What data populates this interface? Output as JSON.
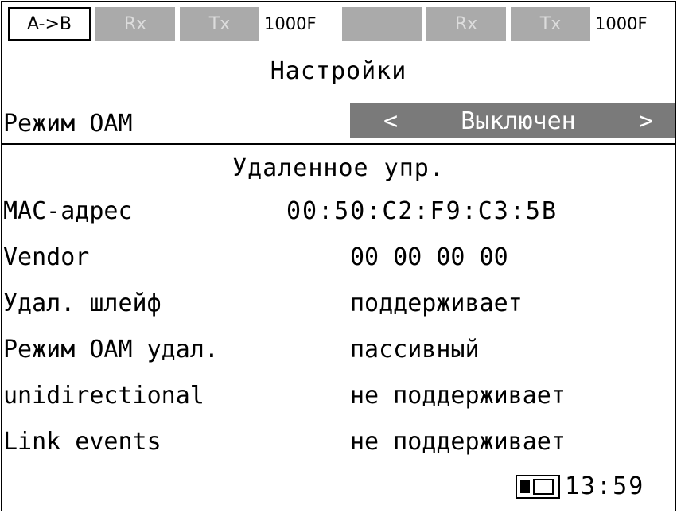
{
  "topbar": {
    "mode": "A->B",
    "port1": {
      "rx": "Rx",
      "tx": "Tx",
      "speed": "1000F"
    },
    "port2": {
      "rx": "Rx",
      "tx": "Tx",
      "speed": "1000F"
    }
  },
  "title": "Настройки",
  "oam": {
    "label": "Режим OAM",
    "value": "Выключен",
    "prev": "<",
    "next": ">"
  },
  "section": "Удаленное упр.",
  "rows": [
    {
      "key": "MAC-адрес",
      "value": "00:50:C2:F9:C3:5B"
    },
    {
      "key": "Vendor",
      "value": "00 00 00 00"
    },
    {
      "key": "Удал. шлейф",
      "value": "поддерживает"
    },
    {
      "key": "Режим OAM удал.",
      "value": "пассивный"
    },
    {
      "key": "unidirectional",
      "value": "не поддерживает"
    },
    {
      "key": "Link events",
      "value": "не поддерживает"
    }
  ],
  "status": {
    "battery_icon": "battery-charging-icon",
    "time": "13:59"
  },
  "colors": {
    "indicator_gray": "#aaaaaa",
    "selector_gray": "#7a7a7a"
  }
}
